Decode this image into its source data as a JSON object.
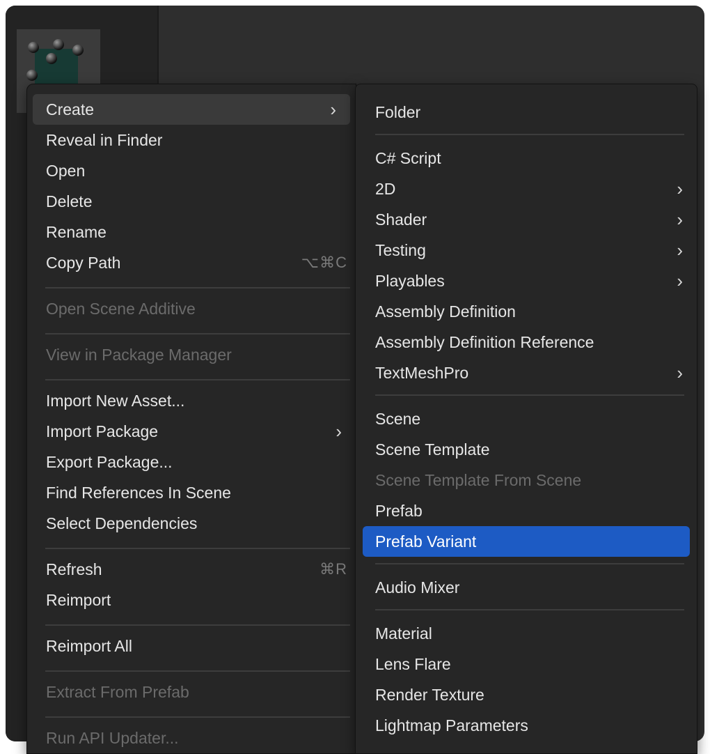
{
  "main_menu": {
    "items": [
      {
        "label": "Create",
        "arrow": "›"
      },
      {
        "label": "Reveal in Finder"
      },
      {
        "label": "Open"
      },
      {
        "label": "Delete"
      },
      {
        "label": "Rename"
      },
      {
        "label": "Copy Path",
        "shortcut": "⌥⌘C"
      },
      {
        "label": "Open Scene Additive"
      },
      {
        "label": "View in Package Manager"
      },
      {
        "label": "Import New Asset..."
      },
      {
        "label": "Import Package",
        "arrow": "›"
      },
      {
        "label": "Export Package..."
      },
      {
        "label": "Find References In Scene"
      },
      {
        "label": "Select Dependencies"
      },
      {
        "label": "Refresh",
        "shortcut": "⌘R"
      },
      {
        "label": "Reimport"
      },
      {
        "label": "Reimport All"
      },
      {
        "label": "Extract From Prefab"
      },
      {
        "label": "Run API Updater..."
      }
    ]
  },
  "sub_menu": {
    "items": [
      {
        "label": "Folder"
      },
      {
        "label": "C# Script"
      },
      {
        "label": "2D",
        "arrow": "›"
      },
      {
        "label": "Shader",
        "arrow": "›"
      },
      {
        "label": "Testing",
        "arrow": "›"
      },
      {
        "label": "Playables",
        "arrow": "›"
      },
      {
        "label": "Assembly Definition"
      },
      {
        "label": "Assembly Definition Reference"
      },
      {
        "label": "TextMeshPro",
        "arrow": "›"
      },
      {
        "label": "Scene"
      },
      {
        "label": "Scene Template"
      },
      {
        "label": "Scene Template From Scene"
      },
      {
        "label": "Prefab"
      },
      {
        "label": "Prefab Variant"
      },
      {
        "label": "Audio Mixer"
      },
      {
        "label": "Material"
      },
      {
        "label": "Lens Flare"
      },
      {
        "label": "Render Texture"
      },
      {
        "label": "Lightmap Parameters"
      }
    ]
  },
  "colors": {
    "selected_highlight": "#1d5bc4",
    "menu_background": "#262626",
    "disabled_text": "#6b6b6b"
  },
  "icons": {
    "asset_thumbnail": "cube-prefab-icon",
    "submenu_arrow": "chevron-right-icon"
  }
}
